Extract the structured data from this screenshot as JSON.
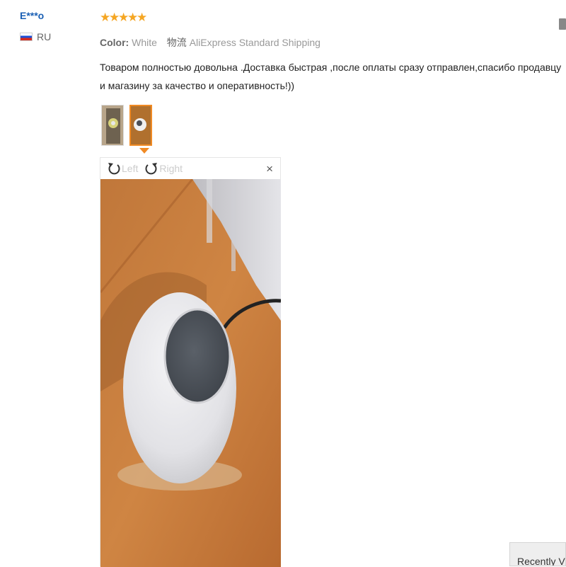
{
  "reviewer": {
    "name": "E***o",
    "country_code": "RU"
  },
  "rating": {
    "stars": 5,
    "max": 5
  },
  "meta": {
    "color_label": "Color:",
    "color_value": "White",
    "ship_label": "物流",
    "ship_value": "AliExpress Standard Shipping"
  },
  "review_text": "Товаром полностью довольна .Доставка быстрая ,после оплаты сразу отправлен,спасибо продавцу и магазину за качество и оперативность!))",
  "viewer": {
    "rotate_left_label": "Left",
    "rotate_right_label": "Right",
    "close_label": "×",
    "selected_thumbnail": 2
  },
  "recently_viewed_label": "Recently Vie",
  "colors": {
    "accent": "#f08a24",
    "link": "#1a5fb4",
    "star": "#f5a623"
  }
}
